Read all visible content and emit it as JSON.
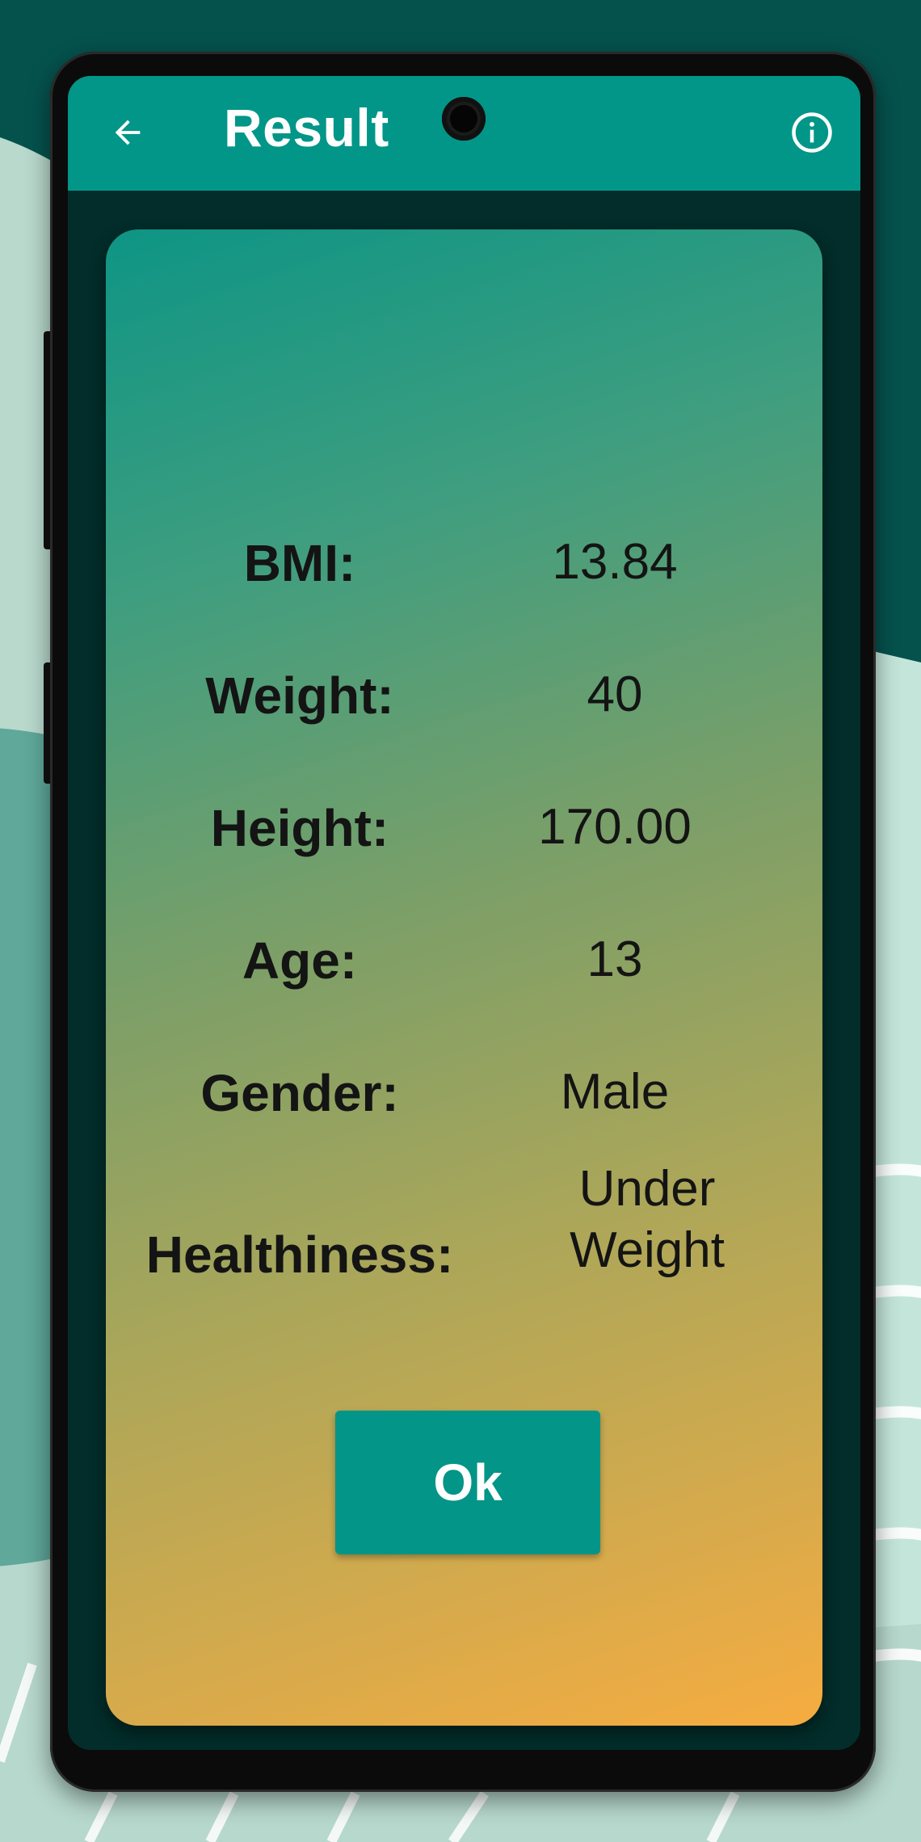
{
  "app": {
    "title": "Result",
    "colors": {
      "appbar": "#029688",
      "button": "#039587",
      "gradient_start": "#0e9585",
      "gradient_end": "#f6ac40",
      "background": "#05524d"
    }
  },
  "header": {
    "back_icon": "arrow-left-icon",
    "info_icon": "info-icon"
  },
  "results": [
    {
      "label": "BMI:",
      "value": "13.84"
    },
    {
      "label": "Weight:",
      "value": "40"
    },
    {
      "label": "Height:",
      "value": "170.00"
    },
    {
      "label": "Age:",
      "value": "13"
    },
    {
      "label": "Gender:",
      "value": "Male"
    }
  ],
  "healthiness": {
    "label": "Healthiness:",
    "value_line1": "Under",
    "value_line2": "Weight"
  },
  "actions": {
    "ok_label": "Ok"
  }
}
